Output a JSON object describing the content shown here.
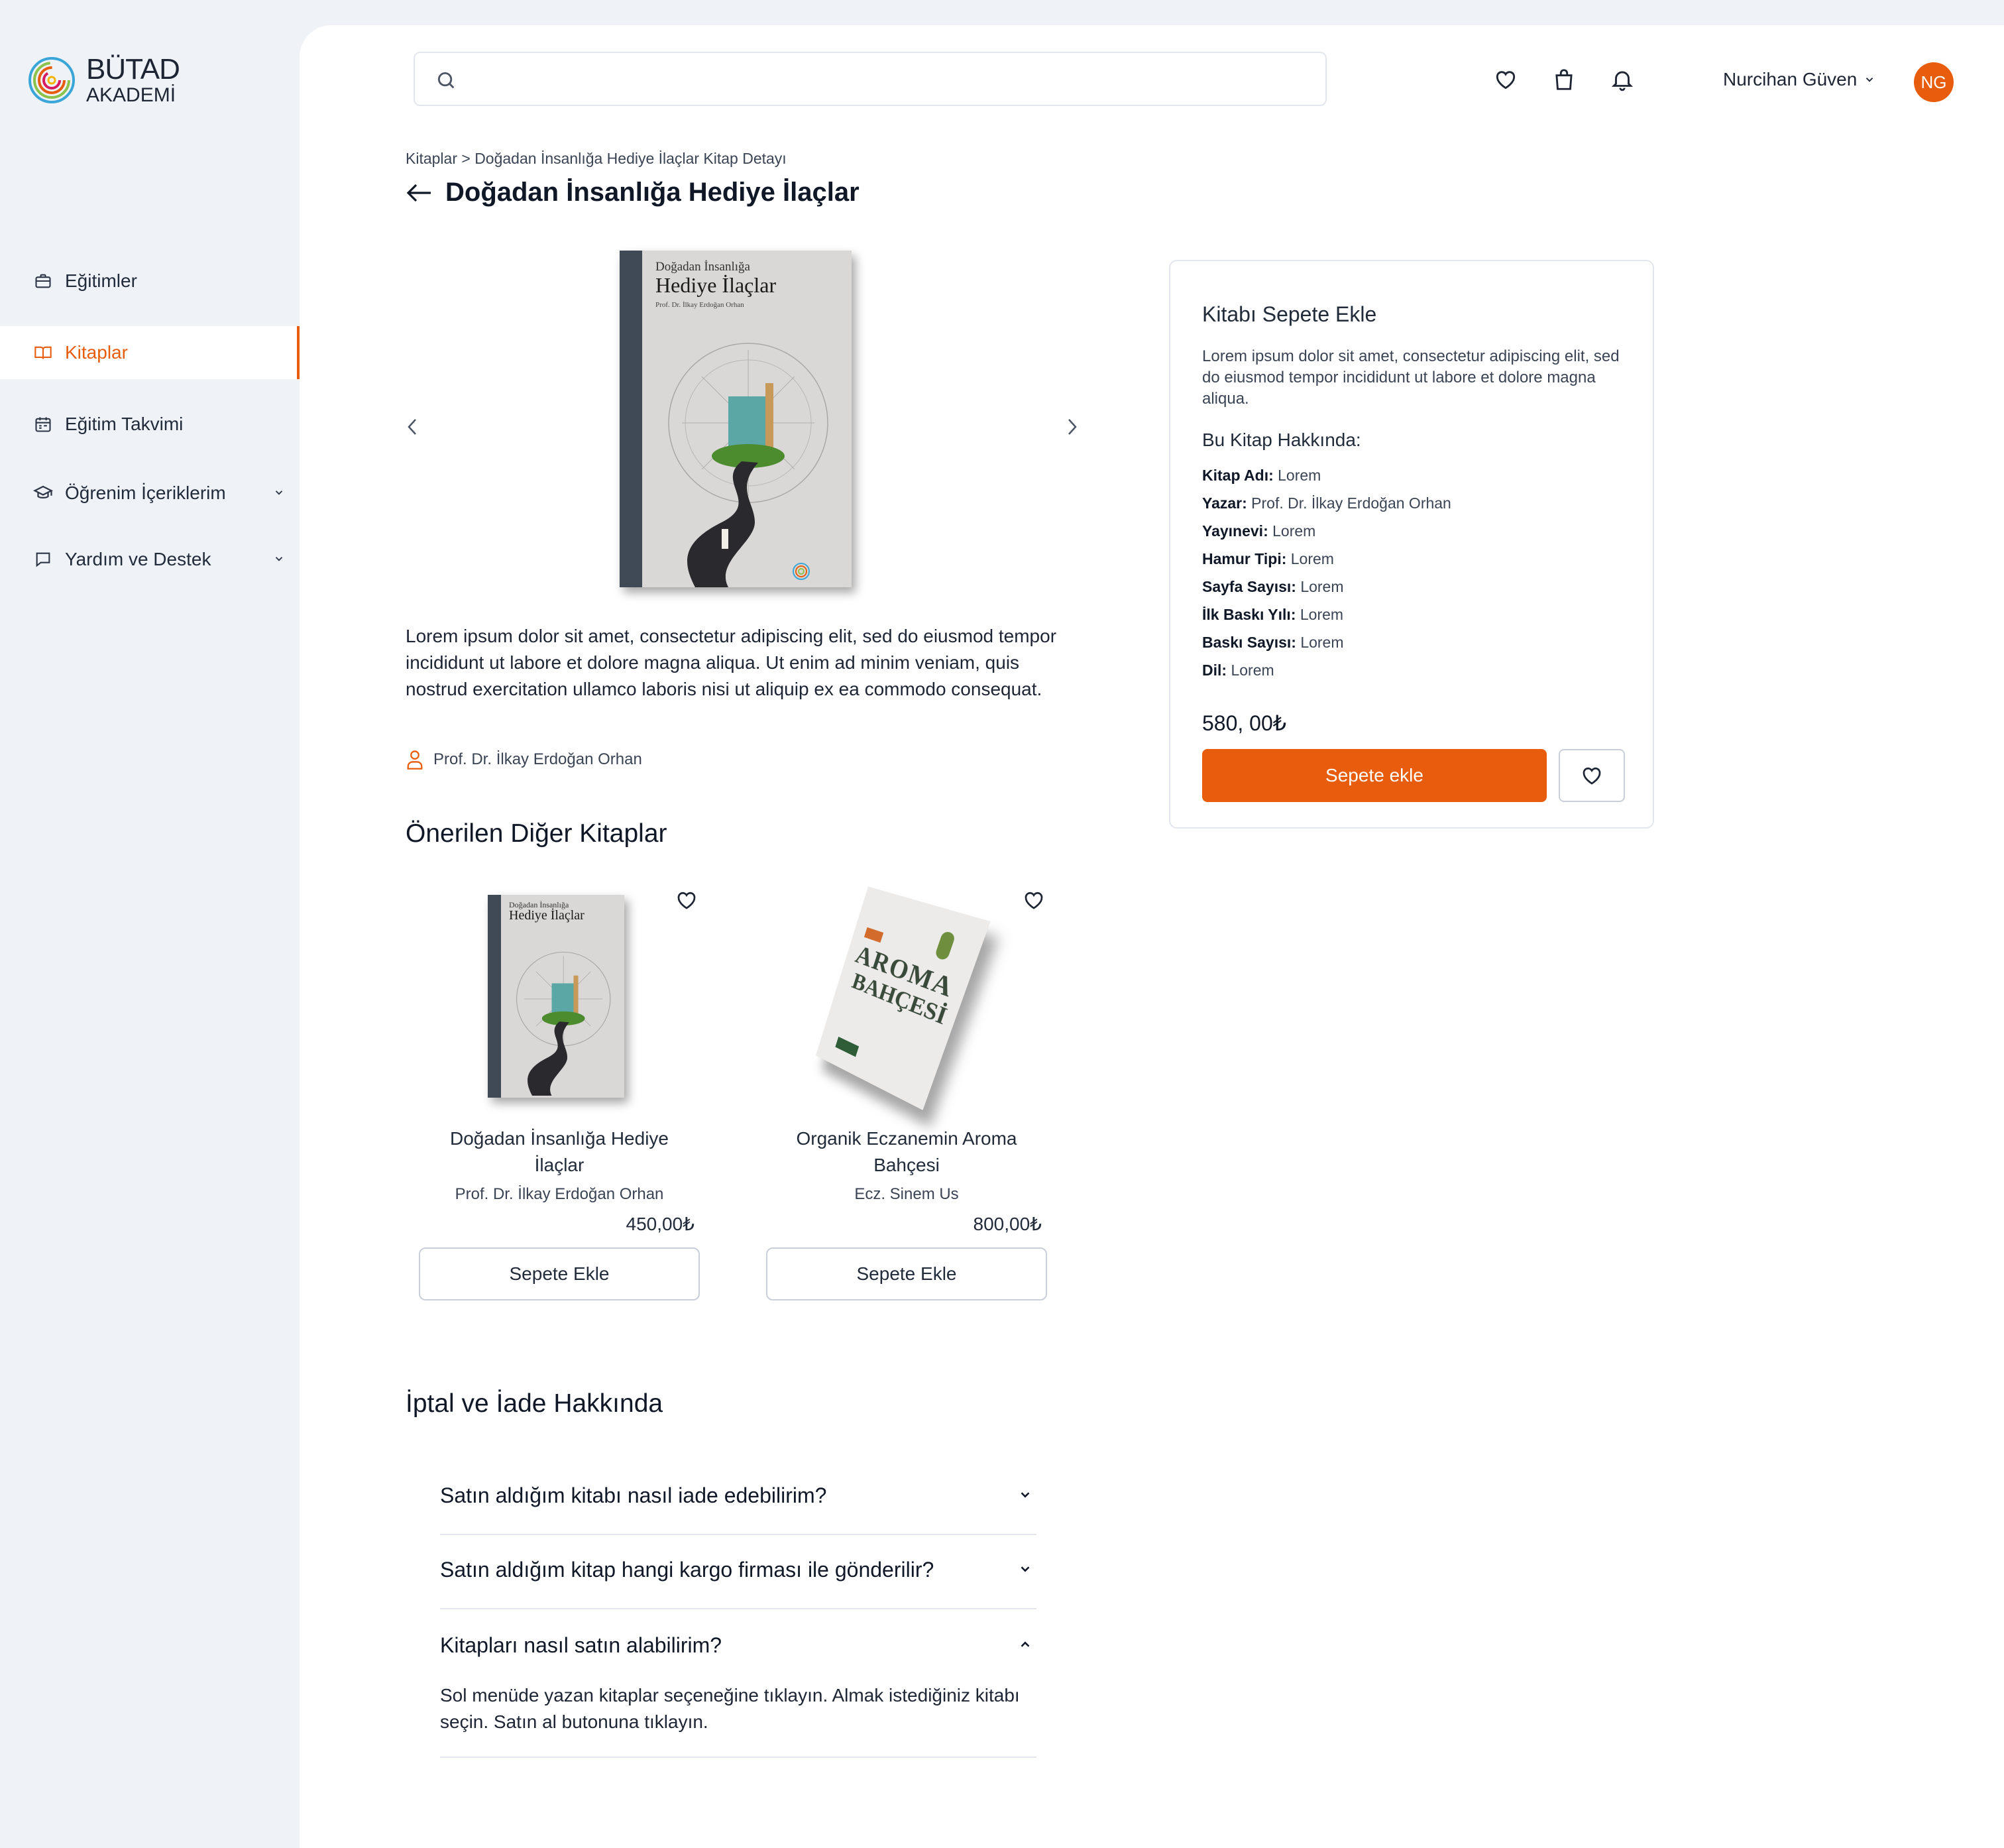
{
  "brand": {
    "line1": "BÜTAD",
    "line2": "AKADEMİ",
    "accent": "#e85d0d"
  },
  "sidebar": {
    "items": [
      {
        "label": "Eğitimler",
        "icon": "briefcase-icon"
      },
      {
        "label": "Kitaplar",
        "icon": "book-open-icon",
        "active": true
      },
      {
        "label": "Eğitim Takvimi",
        "icon": "calendar-icon"
      },
      {
        "label": "Öğrenim İçeriklerim",
        "icon": "graduation-cap-icon",
        "expandable": true
      },
      {
        "label": "Yardım ve Destek",
        "icon": "chat-bubble-icon",
        "expandable": true
      }
    ]
  },
  "header": {
    "search": {
      "value": "",
      "placeholder": ""
    },
    "icons": [
      "heart-icon",
      "shopping-bag-icon",
      "bell-icon"
    ],
    "user": {
      "name": "Nurcihan Güven",
      "initials": "NG"
    }
  },
  "page": {
    "breadcrumb": "Kitaplar > Doğadan İnsanlığa Hediye İlaçlar Kitap Detayı",
    "title": "Doğadan İnsanlığa Hediye İlaçlar",
    "cover": {
      "line1": "Doğadan İnsanlığa",
      "line2": "Hediye İlaçlar",
      "line3": "Prof. Dr. İlkay Erdoğan Orhan",
      "publisher": "BÜTAD"
    },
    "description": "Lorem ipsum dolor sit amet, consectetur adipiscing elit, sed do eiusmod tempor incididunt ut labore et dolore magna aliqua. Ut enim ad minim veniam, quis nostrud exercitation ullamco laboris nisi ut aliquip ex ea commodo consequat.",
    "author": "Prof. Dr. İlkay Erdoğan Orhan"
  },
  "recommended": {
    "title": "Önerilen Diğer Kitaplar",
    "books": [
      {
        "title": "Doğadan İnsanlığa Hediye İlaçlar",
        "author": "Prof. Dr. İlkay Erdoğan Orhan",
        "price": "450,00₺",
        "button": "Sepete Ekle",
        "cover_line1": "Doğadan İnsanlığa",
        "cover_line2": "Hediye İlaçlar"
      },
      {
        "title": "Organik Eczanemin Aroma Bahçesi",
        "author": "Ecz. Sinem Us",
        "price": "800,00₺",
        "button": "Sepete Ekle",
        "cover_line1": "AROMA",
        "cover_line2": "BAHÇESİ"
      }
    ]
  },
  "buy_card": {
    "title": "Kitabı Sepete Ekle",
    "description": "Lorem ipsum dolor sit amet, consectetur adipiscing elit, sed do eiusmod tempor incididunt ut labore et dolore magna aliqua.",
    "about_title": "Bu Kitap Hakkında:",
    "specs": [
      {
        "label": "Kitap Adı:",
        "value": "Lorem"
      },
      {
        "label": "Yazar:",
        "value": "Prof. Dr. İlkay Erdoğan Orhan"
      },
      {
        "label": "Yayınevi:",
        "value": "Lorem"
      },
      {
        "label": "Hamur Tipi:",
        "value": "Lorem"
      },
      {
        "label": "Sayfa Sayısı:",
        "value": "Lorem"
      },
      {
        "label": "İlk Baskı Yılı:",
        "value": "Lorem"
      },
      {
        "label": "Baskı Sayısı:",
        "value": "Lorem"
      },
      {
        "label": "Dil:",
        "value": "Lorem"
      }
    ],
    "price": "580, 00₺",
    "add_button": "Sepete ekle"
  },
  "faq": {
    "title": "İptal ve İade Hakkında",
    "items": [
      {
        "question": "Satın aldığım kitabı nasıl iade edebilirim?",
        "expanded": false
      },
      {
        "question": "Satın aldığım kitap hangi kargo firması ile gönderilir?",
        "expanded": false
      },
      {
        "question": "Kitapları nasıl satın alabilirim?",
        "expanded": true,
        "answer": "Sol menüde yazan kitaplar seçeneğine tıklayın. Almak istediğiniz kitabı seçin. Satın al butonuna tıklayın."
      }
    ]
  }
}
